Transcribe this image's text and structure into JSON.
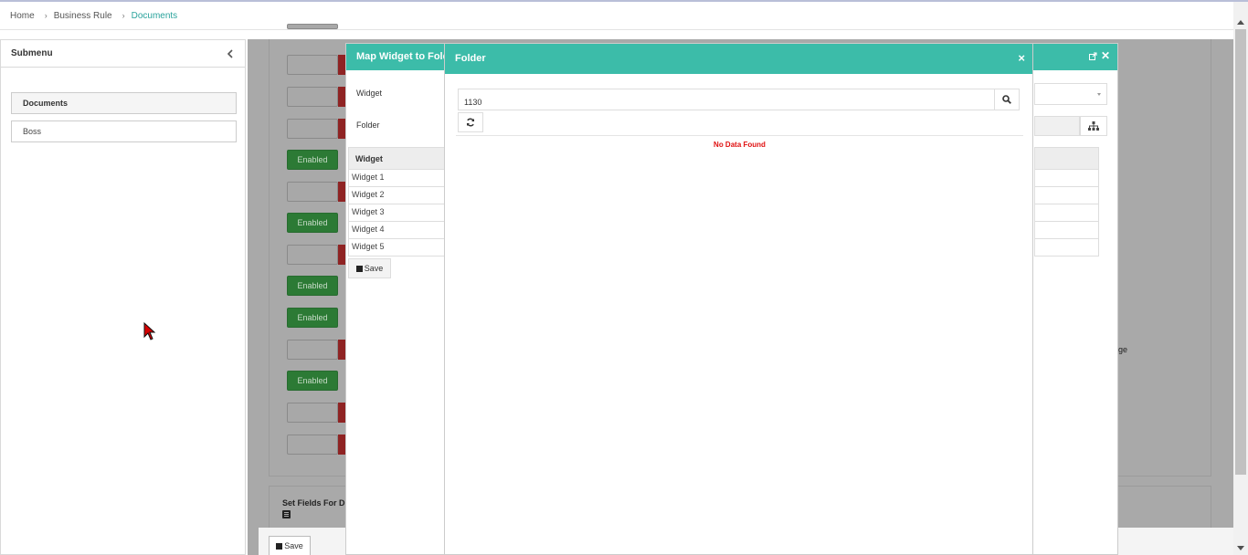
{
  "breadcrumb": {
    "items": [
      "Home",
      "Business Rule"
    ],
    "current": "Documents"
  },
  "submenu": {
    "title": "Submenu",
    "items": [
      {
        "label": "Documents",
        "active": true
      },
      {
        "label": "Boss",
        "active": false
      }
    ]
  },
  "background": {
    "enabled_label": "Enabled",
    "section_title": "Set Fields For D",
    "save_label": "Save",
    "partial_text": "ge"
  },
  "map_modal": {
    "title": "Map Widget to Folder",
    "widget_label": "Widget",
    "folder_label": "Folder",
    "table_header": "Widget",
    "rows": [
      "Widget 1",
      "Widget 2",
      "Widget 3",
      "Widget 4",
      "Widget 5"
    ],
    "save_label": "Save"
  },
  "folder_modal": {
    "title": "Folder",
    "search_value": "1130",
    "no_data": "No Data Found"
  },
  "colors": {
    "header": "#3cbca9",
    "enabled": "#2c7a35",
    "disabled_marker": "#8f2323",
    "no_data": "#e01010",
    "breadcrumb_active": "#2aa39c"
  }
}
